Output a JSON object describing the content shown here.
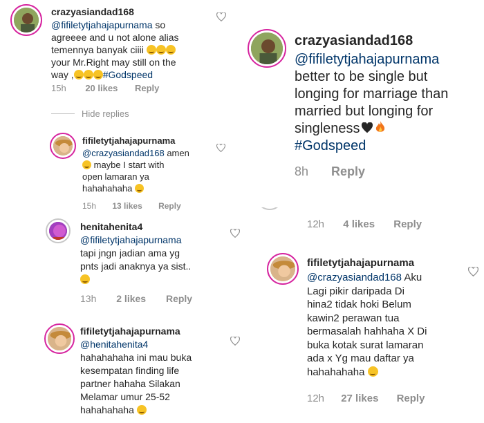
{
  "c1": {
    "username": "crazyasiandad168",
    "mention": "@fifiletytjahajapurnama",
    "line1_rest": " so",
    "line2": "agreeee and u not alone alias",
    "line3": "temennya banyak ciiii ",
    "line4": "your Mr.Right may still on the",
    "line5a": "way ,",
    "tag": "#Godspeed",
    "time": "15h",
    "likes": "20 likes",
    "reply": "Reply"
  },
  "hide_replies": "Hide replies",
  "r1": {
    "username": "fifiletytjahajapurnama",
    "mention": "@crazyasiandad168",
    "line1_rest": " amen",
    "line2": " maybe I start with",
    "line3": "open lamaran ya",
    "line4": "hahahahaha ",
    "time": "15h",
    "likes": "13 likes",
    "reply": "Reply"
  },
  "c2": {
    "username": "henitahenita4",
    "mention": "@fifiletytjahajapurnama",
    "line2": "tapi jngn jadian ama yg",
    "line3": "pnts jadi anaknya ya sist..",
    "time": "13h",
    "likes": "2 likes",
    "reply": "Reply"
  },
  "r2": {
    "username": "fifiletytjahajapurnama",
    "mention": "@henitahenita4",
    "line2": "hahahahaha ini mau buka",
    "line3": "kesempatan finding life",
    "line4": "partner hahaha Silakan",
    "line5": "Melamar umur 25-52",
    "line6": "hahahahaha "
  },
  "big": {
    "username": "crazyasiandad168",
    "mention": "@fifiletytjahajapurnama",
    "line2": "better to be single but",
    "line3": "longing for marriage than",
    "line4": "married but longing for",
    "line5": "singleness",
    "tag": "#Godspeed",
    "time": "8h",
    "reply": "Reply"
  },
  "mid": {
    "time": "12h",
    "likes": "4 likes",
    "reply": "Reply"
  },
  "r3": {
    "username": "fifiletytjahajapurnama",
    "mention": "@crazyasiandad168",
    "line1_rest": " Aku",
    "line2": "Lagi pikir daripada Di",
    "line3": "hina2 tidak hoki Belum",
    "line4": "kawin2 perawan tua",
    "line5": "bermasalah  hahhaha X Di",
    "line6": "buka kotak surat lamaran",
    "line7": "ada x Yg mau daftar ya",
    "line8": "hahahahaha ",
    "time": "12h",
    "likes": "27 likes",
    "reply": "Reply"
  },
  "colors": {
    "mention": "#003569",
    "meta": "#8e8e8e",
    "ring": "#d6249f"
  }
}
